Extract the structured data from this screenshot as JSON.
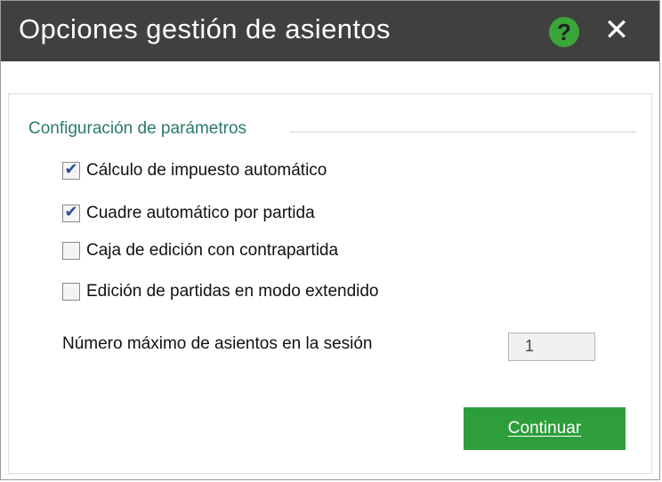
{
  "window": {
    "title": "Opciones gestión de asientos",
    "help_icon": "question-circle-icon",
    "help_glyph": "?",
    "close_icon": "x-icon",
    "close_glyph": "✕"
  },
  "group": {
    "title": "Configuración de parámetros",
    "options": [
      {
        "label": "Cálculo de impuesto automático",
        "checked": true
      },
      {
        "label": "Cuadre automático por partida",
        "checked": true
      },
      {
        "label": "Caja de edición con contrapartida",
        "checked": false
      },
      {
        "label": "Edición de partidas en modo extendido",
        "checked": false
      }
    ],
    "max_sessions": {
      "label": "Número máximo de asientos en la sesión",
      "value": "1"
    }
  },
  "actions": {
    "continue_label": "Continuar"
  },
  "colors": {
    "titlebar": "#404040",
    "accent_green": "#2d9e3b",
    "group_title": "#2b7a6b"
  }
}
